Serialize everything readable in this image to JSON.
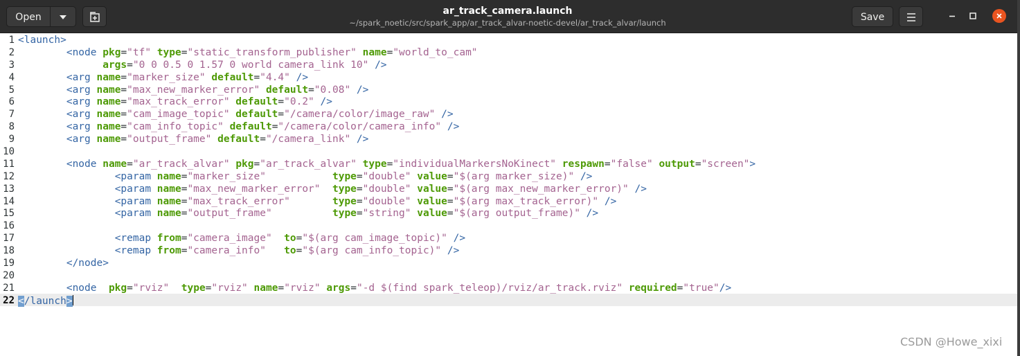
{
  "header": {
    "open_label": "Open",
    "save_label": "Save",
    "title": "ar_track_camera.launch",
    "subtitle": "~/spark_noetic/src/spark_app/ar_track_alvar-noetic-devel/ar_track_alvar/launch"
  },
  "colors": {
    "tag": "#3465a4",
    "attribute": "#4e9a06",
    "value": "#a46390",
    "close": "#e95420"
  },
  "editor": {
    "current_line": 22,
    "line_numbers": [
      "1",
      "2",
      "3",
      "4",
      "5",
      "6",
      "7",
      "8",
      "9",
      "10",
      "11",
      "12",
      "13",
      "14",
      "15",
      "16",
      "17",
      "18",
      "19",
      "20",
      "21",
      "22"
    ],
    "lines": [
      [
        {
          "k": "t",
          "s": "<launch>"
        }
      ],
      [
        {
          "k": "p",
          "s": "        "
        },
        {
          "k": "t",
          "s": "<node "
        },
        {
          "k": "a",
          "s": "pkg"
        },
        {
          "k": "p",
          "s": "="
        },
        {
          "k": "v",
          "s": "\"tf\""
        },
        {
          "k": "p",
          "s": " "
        },
        {
          "k": "a",
          "s": "type"
        },
        {
          "k": "p",
          "s": "="
        },
        {
          "k": "v",
          "s": "\"static_transform_publisher\""
        },
        {
          "k": "p",
          "s": " "
        },
        {
          "k": "a",
          "s": "name"
        },
        {
          "k": "p",
          "s": "="
        },
        {
          "k": "v",
          "s": "\"world_to_cam\""
        }
      ],
      [
        {
          "k": "p",
          "s": "              "
        },
        {
          "k": "a",
          "s": "args"
        },
        {
          "k": "p",
          "s": "="
        },
        {
          "k": "v",
          "s": "\"0 0 0.5 0 1.57 0 world camera_link 10\""
        },
        {
          "k": "p",
          "s": " "
        },
        {
          "k": "t",
          "s": "/>"
        }
      ],
      [
        {
          "k": "p",
          "s": "        "
        },
        {
          "k": "t",
          "s": "<arg "
        },
        {
          "k": "a",
          "s": "name"
        },
        {
          "k": "p",
          "s": "="
        },
        {
          "k": "v",
          "s": "\"marker_size\""
        },
        {
          "k": "p",
          "s": " "
        },
        {
          "k": "a",
          "s": "default"
        },
        {
          "k": "p",
          "s": "="
        },
        {
          "k": "v",
          "s": "\"4.4\""
        },
        {
          "k": "p",
          "s": " "
        },
        {
          "k": "t",
          "s": "/>"
        }
      ],
      [
        {
          "k": "p",
          "s": "        "
        },
        {
          "k": "t",
          "s": "<arg "
        },
        {
          "k": "a",
          "s": "name"
        },
        {
          "k": "p",
          "s": "="
        },
        {
          "k": "v",
          "s": "\"max_new_marker_error\""
        },
        {
          "k": "p",
          "s": " "
        },
        {
          "k": "a",
          "s": "default"
        },
        {
          "k": "p",
          "s": "="
        },
        {
          "k": "v",
          "s": "\"0.08\""
        },
        {
          "k": "p",
          "s": " "
        },
        {
          "k": "t",
          "s": "/>"
        }
      ],
      [
        {
          "k": "p",
          "s": "        "
        },
        {
          "k": "t",
          "s": "<arg "
        },
        {
          "k": "a",
          "s": "name"
        },
        {
          "k": "p",
          "s": "="
        },
        {
          "k": "v",
          "s": "\"max_track_error\""
        },
        {
          "k": "p",
          "s": " "
        },
        {
          "k": "a",
          "s": "default"
        },
        {
          "k": "p",
          "s": "="
        },
        {
          "k": "v",
          "s": "\"0.2\""
        },
        {
          "k": "p",
          "s": " "
        },
        {
          "k": "t",
          "s": "/>"
        }
      ],
      [
        {
          "k": "p",
          "s": "        "
        },
        {
          "k": "t",
          "s": "<arg "
        },
        {
          "k": "a",
          "s": "name"
        },
        {
          "k": "p",
          "s": "="
        },
        {
          "k": "v",
          "s": "\"cam_image_topic\""
        },
        {
          "k": "p",
          "s": " "
        },
        {
          "k": "a",
          "s": "default"
        },
        {
          "k": "p",
          "s": "="
        },
        {
          "k": "v",
          "s": "\"/camera/color/image_raw\""
        },
        {
          "k": "p",
          "s": " "
        },
        {
          "k": "t",
          "s": "/>"
        }
      ],
      [
        {
          "k": "p",
          "s": "        "
        },
        {
          "k": "t",
          "s": "<arg "
        },
        {
          "k": "a",
          "s": "name"
        },
        {
          "k": "p",
          "s": "="
        },
        {
          "k": "v",
          "s": "\"cam_info_topic\""
        },
        {
          "k": "p",
          "s": " "
        },
        {
          "k": "a",
          "s": "default"
        },
        {
          "k": "p",
          "s": "="
        },
        {
          "k": "v",
          "s": "\"/camera/color/camera_info\""
        },
        {
          "k": "p",
          "s": " "
        },
        {
          "k": "t",
          "s": "/>"
        }
      ],
      [
        {
          "k": "p",
          "s": "        "
        },
        {
          "k": "t",
          "s": "<arg "
        },
        {
          "k": "a",
          "s": "name"
        },
        {
          "k": "p",
          "s": "="
        },
        {
          "k": "v",
          "s": "\"output_frame\""
        },
        {
          "k": "p",
          "s": " "
        },
        {
          "k": "a",
          "s": "default"
        },
        {
          "k": "p",
          "s": "="
        },
        {
          "k": "v",
          "s": "\"/camera_link\""
        },
        {
          "k": "p",
          "s": " "
        },
        {
          "k": "t",
          "s": "/>"
        }
      ],
      [],
      [
        {
          "k": "p",
          "s": "        "
        },
        {
          "k": "t",
          "s": "<node "
        },
        {
          "k": "a",
          "s": "name"
        },
        {
          "k": "p",
          "s": "="
        },
        {
          "k": "v",
          "s": "\"ar_track_alvar\""
        },
        {
          "k": "p",
          "s": " "
        },
        {
          "k": "a",
          "s": "pkg"
        },
        {
          "k": "p",
          "s": "="
        },
        {
          "k": "v",
          "s": "\"ar_track_alvar\""
        },
        {
          "k": "p",
          "s": " "
        },
        {
          "k": "a",
          "s": "type"
        },
        {
          "k": "p",
          "s": "="
        },
        {
          "k": "v",
          "s": "\"individualMarkersNoKinect\""
        },
        {
          "k": "p",
          "s": " "
        },
        {
          "k": "a",
          "s": "respawn"
        },
        {
          "k": "p",
          "s": "="
        },
        {
          "k": "v",
          "s": "\"false\""
        },
        {
          "k": "p",
          "s": " "
        },
        {
          "k": "a",
          "s": "output"
        },
        {
          "k": "p",
          "s": "="
        },
        {
          "k": "v",
          "s": "\"screen\""
        },
        {
          "k": "t",
          "s": ">"
        }
      ],
      [
        {
          "k": "p",
          "s": "                "
        },
        {
          "k": "t",
          "s": "<param "
        },
        {
          "k": "a",
          "s": "name"
        },
        {
          "k": "p",
          "s": "="
        },
        {
          "k": "v",
          "s": "\"marker_size\""
        },
        {
          "k": "p",
          "s": "           "
        },
        {
          "k": "a",
          "s": "type"
        },
        {
          "k": "p",
          "s": "="
        },
        {
          "k": "v",
          "s": "\"double\""
        },
        {
          "k": "p",
          "s": " "
        },
        {
          "k": "a",
          "s": "value"
        },
        {
          "k": "p",
          "s": "="
        },
        {
          "k": "v",
          "s": "\"$(arg marker_size)\""
        },
        {
          "k": "p",
          "s": " "
        },
        {
          "k": "t",
          "s": "/>"
        }
      ],
      [
        {
          "k": "p",
          "s": "                "
        },
        {
          "k": "t",
          "s": "<param "
        },
        {
          "k": "a",
          "s": "name"
        },
        {
          "k": "p",
          "s": "="
        },
        {
          "k": "v",
          "s": "\"max_new_marker_error\""
        },
        {
          "k": "p",
          "s": "  "
        },
        {
          "k": "a",
          "s": "type"
        },
        {
          "k": "p",
          "s": "="
        },
        {
          "k": "v",
          "s": "\"double\""
        },
        {
          "k": "p",
          "s": " "
        },
        {
          "k": "a",
          "s": "value"
        },
        {
          "k": "p",
          "s": "="
        },
        {
          "k": "v",
          "s": "\"$(arg max_new_marker_error)\""
        },
        {
          "k": "p",
          "s": " "
        },
        {
          "k": "t",
          "s": "/>"
        }
      ],
      [
        {
          "k": "p",
          "s": "                "
        },
        {
          "k": "t",
          "s": "<param "
        },
        {
          "k": "a",
          "s": "name"
        },
        {
          "k": "p",
          "s": "="
        },
        {
          "k": "v",
          "s": "\"max_track_error\""
        },
        {
          "k": "p",
          "s": "       "
        },
        {
          "k": "a",
          "s": "type"
        },
        {
          "k": "p",
          "s": "="
        },
        {
          "k": "v",
          "s": "\"double\""
        },
        {
          "k": "p",
          "s": " "
        },
        {
          "k": "a",
          "s": "value"
        },
        {
          "k": "p",
          "s": "="
        },
        {
          "k": "v",
          "s": "\"$(arg max_track_error)\""
        },
        {
          "k": "p",
          "s": " "
        },
        {
          "k": "t",
          "s": "/>"
        }
      ],
      [
        {
          "k": "p",
          "s": "                "
        },
        {
          "k": "t",
          "s": "<param "
        },
        {
          "k": "a",
          "s": "name"
        },
        {
          "k": "p",
          "s": "="
        },
        {
          "k": "v",
          "s": "\"output_frame\""
        },
        {
          "k": "p",
          "s": "          "
        },
        {
          "k": "a",
          "s": "type"
        },
        {
          "k": "p",
          "s": "="
        },
        {
          "k": "v",
          "s": "\"string\""
        },
        {
          "k": "p",
          "s": " "
        },
        {
          "k": "a",
          "s": "value"
        },
        {
          "k": "p",
          "s": "="
        },
        {
          "k": "v",
          "s": "\"$(arg output_frame)\""
        },
        {
          "k": "p",
          "s": " "
        },
        {
          "k": "t",
          "s": "/>"
        }
      ],
      [],
      [
        {
          "k": "p",
          "s": "                "
        },
        {
          "k": "t",
          "s": "<remap "
        },
        {
          "k": "a",
          "s": "from"
        },
        {
          "k": "p",
          "s": "="
        },
        {
          "k": "v",
          "s": "\"camera_image\""
        },
        {
          "k": "p",
          "s": "  "
        },
        {
          "k": "a",
          "s": "to"
        },
        {
          "k": "p",
          "s": "="
        },
        {
          "k": "v",
          "s": "\"$(arg cam_image_topic)\""
        },
        {
          "k": "p",
          "s": " "
        },
        {
          "k": "t",
          "s": "/>"
        }
      ],
      [
        {
          "k": "p",
          "s": "                "
        },
        {
          "k": "t",
          "s": "<remap "
        },
        {
          "k": "a",
          "s": "from"
        },
        {
          "k": "p",
          "s": "="
        },
        {
          "k": "v",
          "s": "\"camera_info\""
        },
        {
          "k": "p",
          "s": "   "
        },
        {
          "k": "a",
          "s": "to"
        },
        {
          "k": "p",
          "s": "="
        },
        {
          "k": "v",
          "s": "\"$(arg cam_info_topic)\""
        },
        {
          "k": "p",
          "s": " "
        },
        {
          "k": "t",
          "s": "/>"
        }
      ],
      [
        {
          "k": "p",
          "s": "        "
        },
        {
          "k": "t",
          "s": "</node>"
        }
      ],
      [],
      [
        {
          "k": "p",
          "s": "        "
        },
        {
          "k": "t",
          "s": "<node  "
        },
        {
          "k": "a",
          "s": "pkg"
        },
        {
          "k": "p",
          "s": "="
        },
        {
          "k": "v",
          "s": "\"rviz\""
        },
        {
          "k": "p",
          "s": "  "
        },
        {
          "k": "a",
          "s": "type"
        },
        {
          "k": "p",
          "s": "="
        },
        {
          "k": "v",
          "s": "\"rviz\""
        },
        {
          "k": "p",
          "s": " "
        },
        {
          "k": "a",
          "s": "name"
        },
        {
          "k": "p",
          "s": "="
        },
        {
          "k": "v",
          "s": "\"rviz\""
        },
        {
          "k": "p",
          "s": " "
        },
        {
          "k": "a",
          "s": "args"
        },
        {
          "k": "p",
          "s": "="
        },
        {
          "k": "v",
          "s": "\"-d $(find spark_teleop)/rviz/ar_track.rviz\""
        },
        {
          "k": "p",
          "s": " "
        },
        {
          "k": "a",
          "s": "required"
        },
        {
          "k": "p",
          "s": "="
        },
        {
          "k": "v",
          "s": "\"true\""
        },
        {
          "k": "t",
          "s": "/>"
        }
      ],
      [
        {
          "k": "hl",
          "s": "<"
        },
        {
          "k": "t",
          "s": "/launch"
        },
        {
          "k": "hl",
          "s": ">"
        },
        {
          "k": "caret",
          "s": ""
        }
      ]
    ]
  },
  "watermark": "CSDN @Howe_xixi"
}
